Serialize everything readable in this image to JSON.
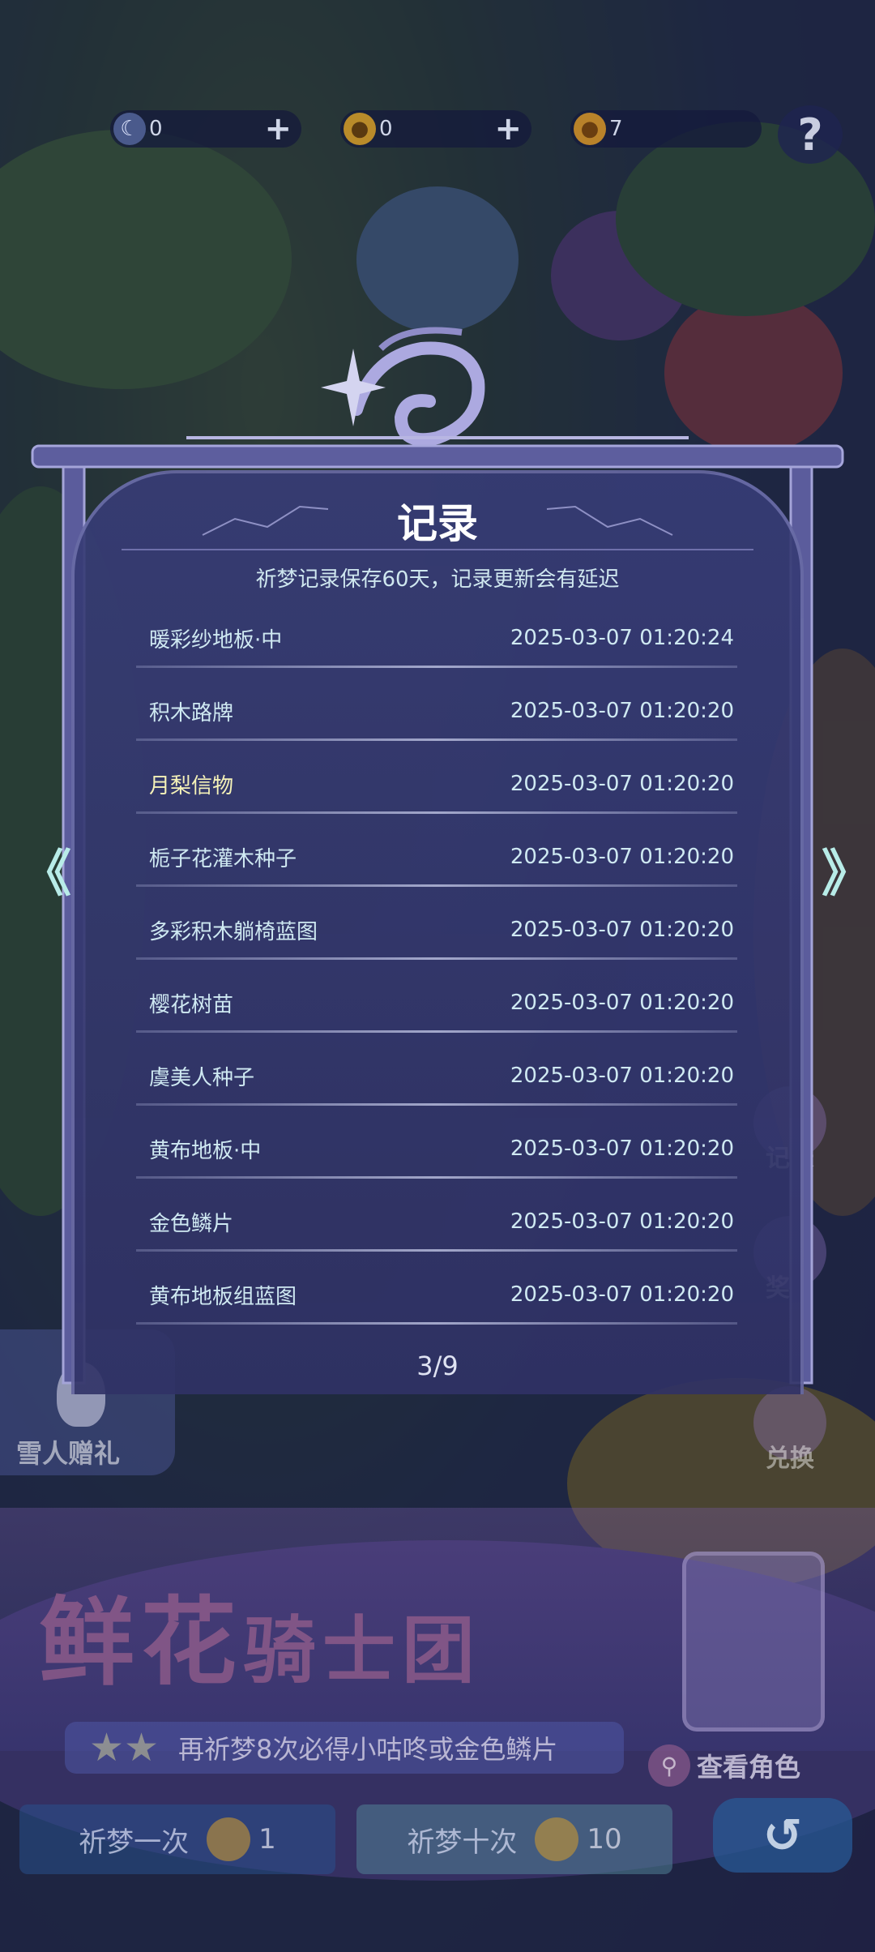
{
  "currency_bar": {
    "moon_count": "0",
    "token_count": "0",
    "coin_count": "7",
    "help_label": "?"
  },
  "dialog": {
    "title": "记录",
    "notice": "祈梦记录保存60天，记录更新会有延迟",
    "records": [
      {
        "name": "暖彩纱地板·中",
        "time": "2025-03-07 01:20:24",
        "rare": false
      },
      {
        "name": "积木路牌",
        "time": "2025-03-07 01:20:20",
        "rare": false
      },
      {
        "name": "月梨信物",
        "time": "2025-03-07 01:20:20",
        "rare": true
      },
      {
        "name": "栀子花灌木种子",
        "time": "2025-03-07 01:20:20",
        "rare": false
      },
      {
        "name": "多彩积木躺椅蓝图",
        "time": "2025-03-07 01:20:20",
        "rare": false
      },
      {
        "name": "樱花树苗",
        "time": "2025-03-07 01:20:20",
        "rare": false
      },
      {
        "name": "虞美人种子",
        "time": "2025-03-07 01:20:20",
        "rare": false
      },
      {
        "name": "黄布地板·中",
        "time": "2025-03-07 01:20:20",
        "rare": false
      },
      {
        "name": "金色鳞片",
        "time": "2025-03-07 01:20:20",
        "rare": false
      },
      {
        "name": "黄布地板组蓝图",
        "time": "2025-03-07 01:20:20",
        "rare": false
      }
    ],
    "page_indicator": "3/9",
    "prev_arrow": "《",
    "next_arrow": "》"
  },
  "side_menu": {
    "record_label": "记录",
    "reward_label": "奖励",
    "exchange_label": "兑换",
    "snowman_gift_label": "雪人赠礼"
  },
  "banner": {
    "title_main": "鲜花",
    "title_small": "骑士团",
    "hint": "再祈梦8次必得小咕咚或金色鳞片",
    "view_role_label": "查看角色"
  },
  "actions": {
    "draw_once_label": "祈梦一次",
    "draw_once_cost": "1",
    "draw_ten_label": "祈梦十次",
    "draw_ten_cost": "10",
    "back_icon": "↺"
  },
  "colors": {
    "panel_bg": "#373c76",
    "text_cyan": "#cfe9f2",
    "text_rare": "#f5f2b8",
    "arrow": "#b8ece8"
  }
}
